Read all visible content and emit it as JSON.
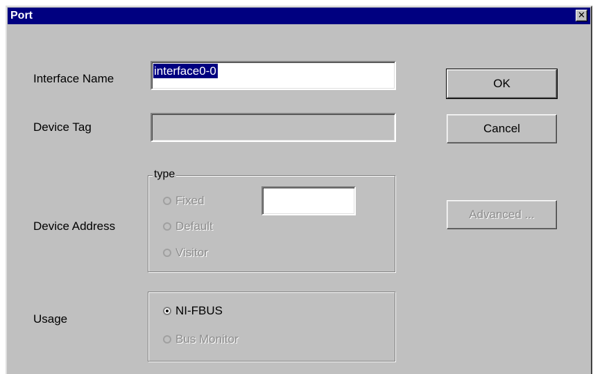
{
  "window": {
    "title": "Port",
    "close_glyph": "✕"
  },
  "interface_name": {
    "label": "Interface Name",
    "value": "interface0-0"
  },
  "device_tag": {
    "label": "Device Tag",
    "value": ""
  },
  "device_address": {
    "label": "Device Address",
    "group_title": "type",
    "options": [
      {
        "label": "Fixed",
        "selected": false,
        "enabled": false
      },
      {
        "label": "Default",
        "selected": false,
        "enabled": false
      },
      {
        "label": "Visitor",
        "selected": false,
        "enabled": false
      }
    ],
    "fixed_value": ""
  },
  "usage": {
    "label": "Usage",
    "options": [
      {
        "label": "NI-FBUS",
        "selected": true,
        "enabled": true
      },
      {
        "label": "Bus Monitor",
        "selected": false,
        "enabled": false
      }
    ]
  },
  "buttons": {
    "ok": "OK",
    "cancel": "Cancel",
    "advanced": "Advanced ..."
  },
  "colors": {
    "titlebar": "#000080",
    "dialog_face": "#c0c0c0",
    "selection": "#000080",
    "disabled_text": "#8c8c8c"
  },
  "icons": {
    "close": "close-icon",
    "radio": "radio-button-icon"
  }
}
